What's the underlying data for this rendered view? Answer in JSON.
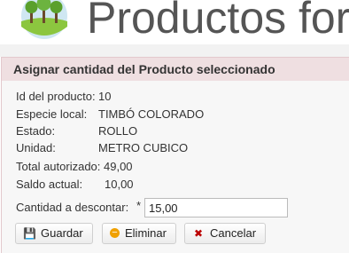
{
  "header": {
    "title": "Productos for"
  },
  "panel": {
    "title": "Asignar cantidad del Producto seleccionado",
    "fields": [
      {
        "label": "Id del producto:",
        "value": "10"
      },
      {
        "label": "Especie local:",
        "value": "TIMBÓ COLORADO"
      },
      {
        "label": "Estado:",
        "value": "ROLLO"
      },
      {
        "label": "Unidad:",
        "value": "METRO CUBICO"
      },
      {
        "label": "Total autorizado:",
        "value": "49,00"
      },
      {
        "label": "Saldo actual:",
        "value": "10,00"
      }
    ],
    "quantity": {
      "label": "Cantidad a descontar:",
      "required_mark": "*",
      "value": "15,00"
    },
    "buttons": {
      "save": "Guardar",
      "remove": "Eliminar",
      "cancel": "Cancelar"
    }
  },
  "icons": {
    "logo": "trees-logo-icon",
    "save": "floppy-disk-icon",
    "remove": "minus-circle-icon",
    "cancel": "x-icon"
  }
}
